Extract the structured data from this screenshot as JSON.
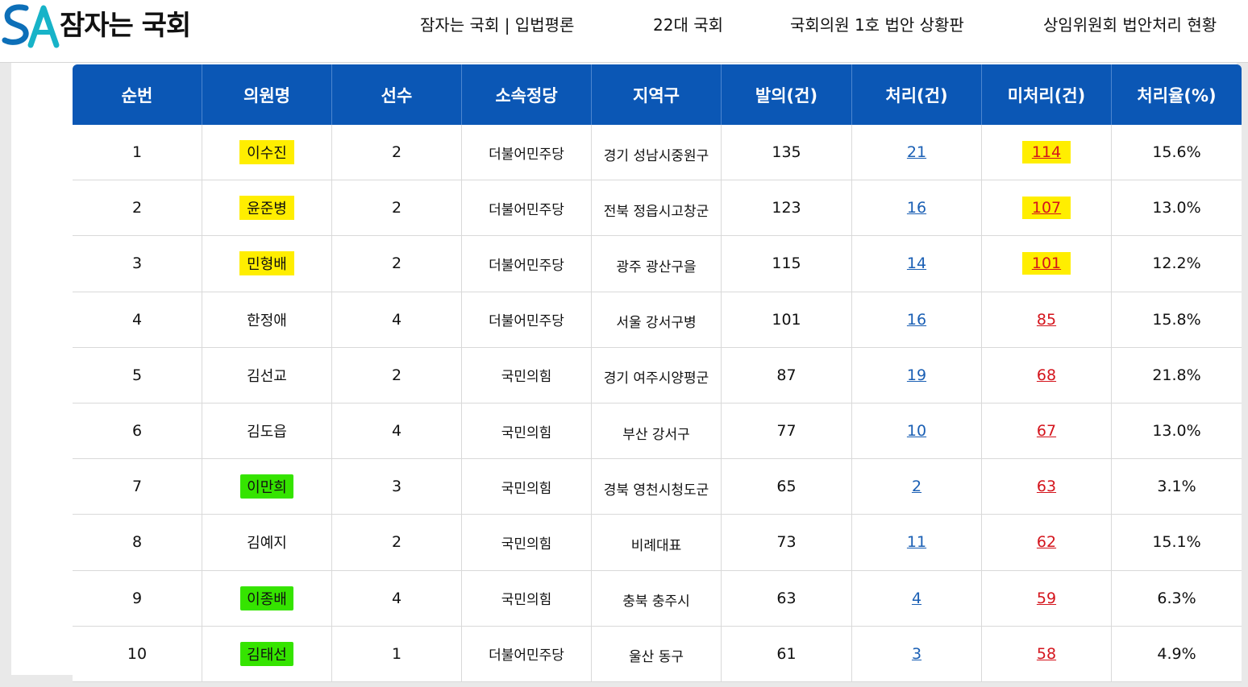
{
  "site": {
    "logo_text": "잠자는 국회",
    "logo_icon": "sa-logo-icon"
  },
  "nav": {
    "items": [
      "잠자는 국회 | 입법평론",
      "22대 국회",
      "국회의원 1호 법안 상황판",
      "상임위원회 법안처리 현황"
    ]
  },
  "table": {
    "headers": [
      "순번",
      "의원명",
      "선수",
      "소속정당",
      "지역구",
      "발의(건)",
      "처리(건)",
      "미처리(건)",
      "처리율(%)"
    ],
    "rows": [
      {
        "no": "1",
        "name": "이수진",
        "terms": "2",
        "party": "더불어민주당",
        "district": "경기 성남시중원구",
        "proposed": "135",
        "processed": "21",
        "unprocessed": "114",
        "rate": "15.6%",
        "name_hl": "yellow",
        "num_hl": "yellow"
      },
      {
        "no": "2",
        "name": "윤준병",
        "terms": "2",
        "party": "더불어민주당",
        "district": "전북 정읍시고창군",
        "proposed": "123",
        "processed": "16",
        "unprocessed": "107",
        "rate": "13.0%",
        "name_hl": "yellow",
        "num_hl": "yellow"
      },
      {
        "no": "3",
        "name": "민형배",
        "terms": "2",
        "party": "더불어민주당",
        "district": "광주 광산구을",
        "proposed": "115",
        "processed": "14",
        "unprocessed": "101",
        "rate": "12.2%",
        "name_hl": "yellow",
        "num_hl": "yellow"
      },
      {
        "no": "4",
        "name": "한정애",
        "terms": "4",
        "party": "더불어민주당",
        "district": "서울 강서구병",
        "proposed": "101",
        "processed": "16",
        "unprocessed": "85",
        "rate": "15.8%",
        "name_hl": "",
        "num_hl": ""
      },
      {
        "no": "5",
        "name": "김선교",
        "terms": "2",
        "party": "국민의힘",
        "district": "경기 여주시양평군",
        "proposed": "87",
        "processed": "19",
        "unprocessed": "68",
        "rate": "21.8%",
        "name_hl": "",
        "num_hl": ""
      },
      {
        "no": "6",
        "name": "김도읍",
        "terms": "4",
        "party": "국민의힘",
        "district": "부산 강서구",
        "proposed": "77",
        "processed": "10",
        "unprocessed": "67",
        "rate": "13.0%",
        "name_hl": "",
        "num_hl": ""
      },
      {
        "no": "7",
        "name": "이만희",
        "terms": "3",
        "party": "국민의힘",
        "district": "경북 영천시청도군",
        "proposed": "65",
        "processed": "2",
        "unprocessed": "63",
        "rate": "3.1%",
        "name_hl": "green",
        "num_hl": ""
      },
      {
        "no": "8",
        "name": "김예지",
        "terms": "2",
        "party": "국민의힘",
        "district": "비례대표",
        "proposed": "73",
        "processed": "11",
        "unprocessed": "62",
        "rate": "15.1%",
        "name_hl": "",
        "num_hl": ""
      },
      {
        "no": "9",
        "name": "이종배",
        "terms": "4",
        "party": "국민의힘",
        "district": "충북 충주시",
        "proposed": "63",
        "processed": "4",
        "unprocessed": "59",
        "rate": "6.3%",
        "name_hl": "green",
        "num_hl": ""
      },
      {
        "no": "10",
        "name": "김태선",
        "terms": "1",
        "party": "더불어민주당",
        "district": "울산 동구",
        "proposed": "61",
        "processed": "3",
        "unprocessed": "58",
        "rate": "4.9%",
        "name_hl": "green",
        "num_hl": ""
      }
    ]
  },
  "colors": {
    "header_bg": "#0b57b5",
    "link_blue": "#1a5fb4",
    "link_red": "#d4141c",
    "highlight_yellow": "#ffee00",
    "highlight_green": "#35e400"
  }
}
